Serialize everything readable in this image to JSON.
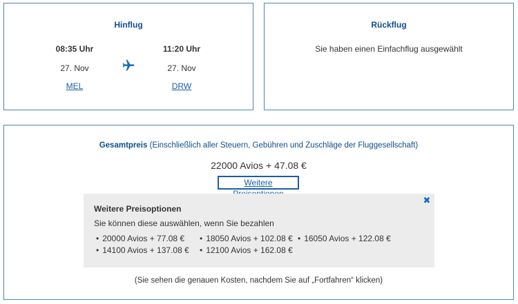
{
  "outbound": {
    "title": "Hinflug",
    "departure": {
      "time": "08:35 Uhr",
      "date": "27. Nov",
      "airport": "MEL"
    },
    "arrival": {
      "time": "11:20 Uhr",
      "date": "27. Nov",
      "airport": "DRW"
    },
    "icon": "airplane-icon"
  },
  "return": {
    "title": "Rückflug",
    "message": "Sie haben einen Einfachflug ausgewählt"
  },
  "price": {
    "label": "Gesamtpreis",
    "label_note": "(Einschließlich aller Steuern, Gebühren und Zuschläge der Fluggesellschaft)",
    "amount": "22000 Avios + 47.08 €",
    "more_options_link": "Weitere Preisoptionen",
    "options_panel": {
      "title": "Weitere Preisoptionen",
      "subtitle": "Sie können diese auswählen, wenn Sie bezahlen",
      "close_label": "✖",
      "options": [
        "20000 Avios + 77.08 €",
        "18050 Avios + 102.08 €",
        "16050 Avios + 122.08 €",
        "14100 Avios + 137.08 €",
        "12100 Avios + 162.08 €"
      ]
    },
    "footer_note": "(Sie sehen die genauen Kosten, nachdem Sie auf „Fortfahren“ klicken)"
  },
  "colors": {
    "accent": "#0f4d8c",
    "link": "#1a5fa0",
    "border": "#4a86b8",
    "panel_bg": "#ececec"
  }
}
